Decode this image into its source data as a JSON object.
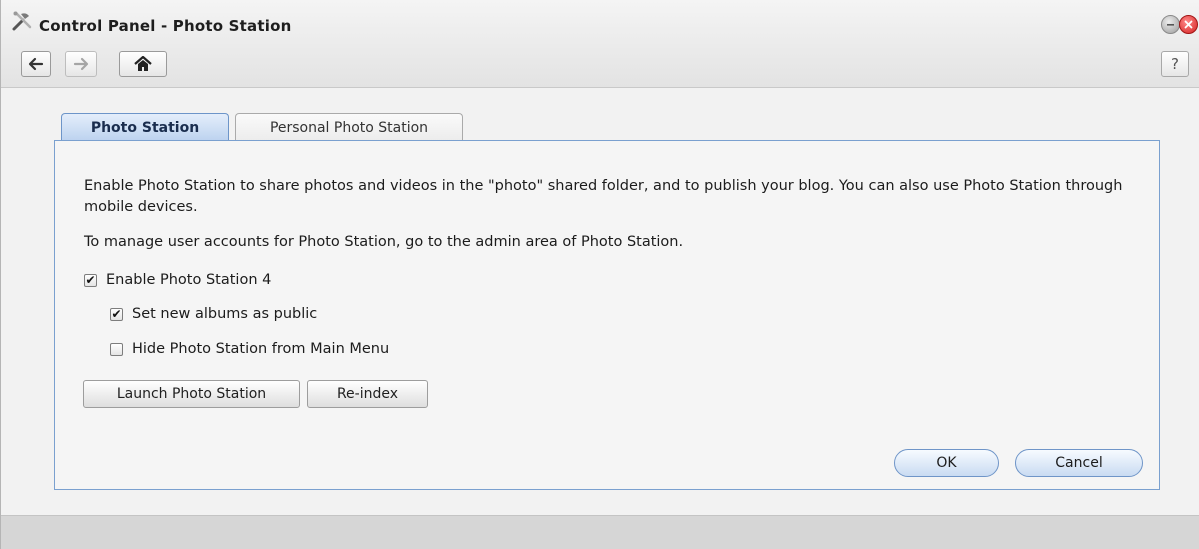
{
  "window": {
    "title": "Control Panel - Photo Station",
    "icons": {
      "app": "tools-icon",
      "minimize": "minimize-icon",
      "close": "close-icon"
    }
  },
  "toolbar": {
    "back": "back-arrow-icon",
    "forward": "forward-arrow-icon",
    "home": "home-icon",
    "help_label": "?"
  },
  "tabs": [
    {
      "label": "Photo Station",
      "active": true
    },
    {
      "label": "Personal Photo Station",
      "active": false
    }
  ],
  "panel": {
    "description": "Enable Photo Station to share photos and videos in the \"photo\" shared folder, and to publish your blog. You can also use Photo Station through mobile devices.",
    "manage_note": "To manage user accounts for Photo Station, go to the admin area of Photo Station.",
    "options": [
      {
        "label": "Enable Photo Station 4",
        "checked": true
      },
      {
        "label": "Set new albums as public",
        "checked": true
      },
      {
        "label": "Hide Photo Station from Main Menu",
        "checked": false
      }
    ],
    "buttons": {
      "launch": "Launch Photo Station",
      "reindex": "Re-index"
    }
  },
  "footer": {
    "ok": "OK",
    "cancel": "Cancel"
  },
  "colors": {
    "tab_active": "#bcd2ef",
    "panel_border": "#7aa0cf",
    "close_button": "#d42020"
  }
}
